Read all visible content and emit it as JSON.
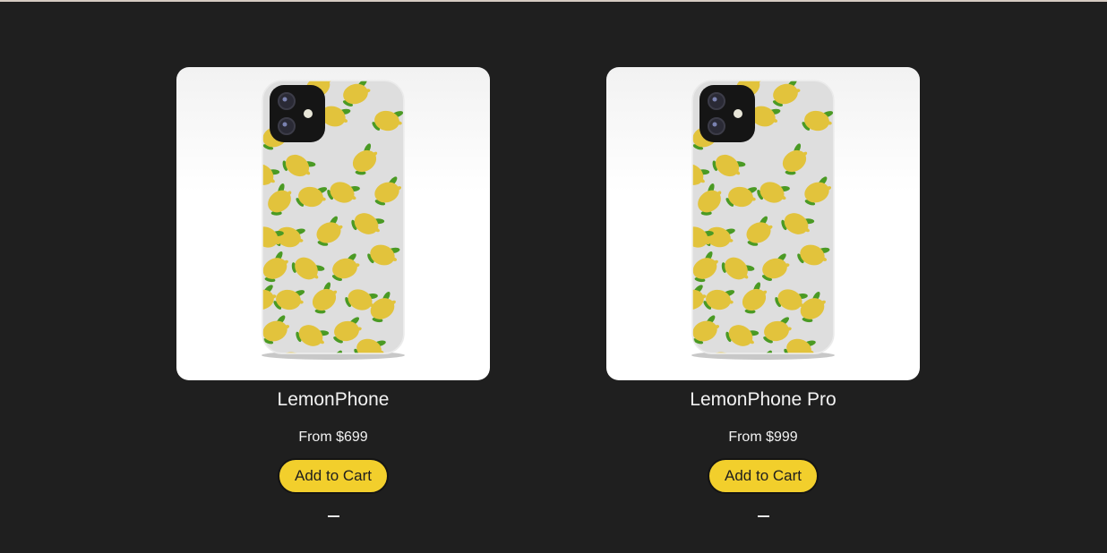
{
  "products": [
    {
      "name": "LemonPhone",
      "price": "From $699",
      "cart_label": "Add to Cart"
    },
    {
      "name": "LemonPhone Pro",
      "price": "From $999",
      "cart_label": "Add to Cart"
    }
  ],
  "colors": {
    "background": "#1f1f1f",
    "button": "#f2cf2c",
    "lemon": "#e2c33c",
    "leaf": "#4a9a24"
  }
}
